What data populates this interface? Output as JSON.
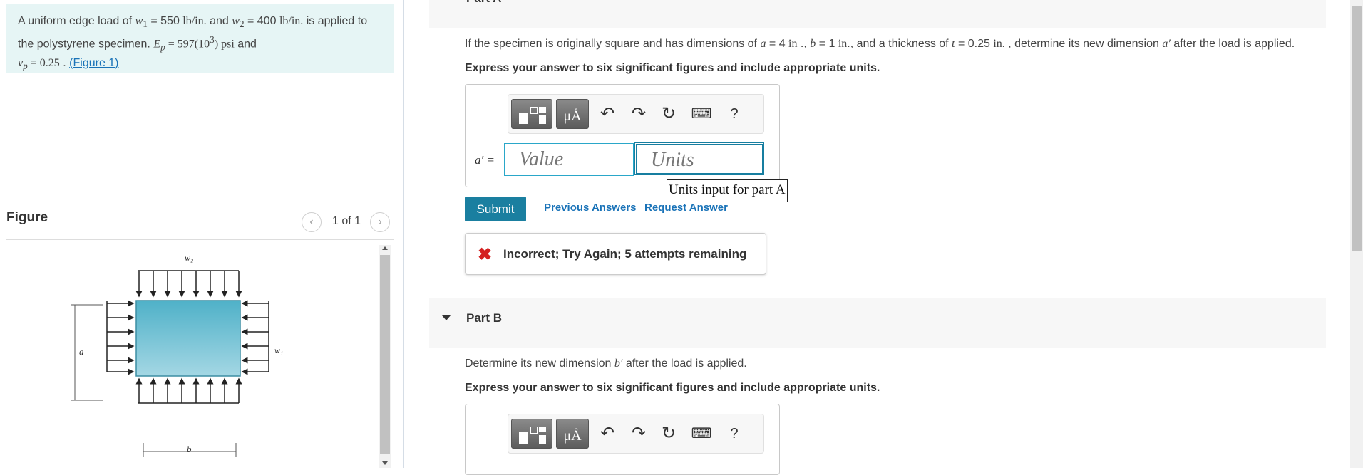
{
  "problem": {
    "text1": "A uniform edge load of ",
    "w1": "w",
    "w1sub": "1",
    "eq1": " = 550 ",
    "unit1": "lb/in.",
    "text2": " and ",
    "w2": "w",
    "w2sub": "2",
    "eq2": " = 400 ",
    "unit2": "lb/in.",
    "text3": " is applied to the polystyrene specimen. ",
    "E": "E",
    "Esub": "p",
    "Eval": " = 597(10",
    "Eexp": "3",
    "Eunit": ") psi",
    "text4": " and",
    "nu": "ν",
    "nusub": "p",
    "nuval": " = 0.25",
    "text5": " . ",
    "figure_link": "(Figure 1)"
  },
  "figure": {
    "title": "Figure",
    "pager_text": "1 of 1",
    "prev_icon": "chevron-left-icon",
    "next_icon": "chevron-right-icon",
    "label_w2": "w₂",
    "label_w1": "w₁",
    "label_a": "a",
    "label_b": "b"
  },
  "partA": {
    "header_label": "Part A",
    "q1": "If the specimen is originally square and has dimensions of ",
    "a": "a",
    "aval": " = 4 ",
    "inunit": "in",
    "sep1": " ., ",
    "b": "b",
    "bval": " = 1 ",
    "inunit2": "in",
    "sep2": "., and a thickness of ",
    "t": "t",
    "tval": " = 0.25 ",
    "inunit3": "in.",
    "q2": " , determine its new dimension ",
    "aprime": "a′",
    "q3": " after the load is applied.",
    "instruction": "Express your answer to six significant figures and include appropriate units.",
    "var_label": "a′ =",
    "value_placeholder": "Value",
    "units_placeholder": "Units",
    "tooltip": "Units input for part A",
    "submit": "Submit",
    "previous_answers": "Previous Answers",
    "request_answer": "Request Answer",
    "feedback": "Incorrect; Try Again; 5 attempts remaining"
  },
  "partB": {
    "header_label": "Part B",
    "q1": "Determine its new dimension ",
    "bprime": "b′",
    "q2": " after the load is applied.",
    "instruction": "Express your answer to six significant figures and include appropriate units."
  },
  "toolbar": {
    "templates_icon": "templates-icon",
    "units_label": "μÅ",
    "undo_icon": "undo-icon",
    "redo_icon": "redo-icon",
    "reset_icon": "reset-icon",
    "keyboard_icon": "keyboard-icon",
    "help_label": "?"
  },
  "colors": {
    "problem_bg": "#e6f5f5",
    "link": "#1a73b8",
    "submit_bg": "#1a7fa0",
    "error": "#d42020",
    "field_border": "#2aa7c9"
  }
}
